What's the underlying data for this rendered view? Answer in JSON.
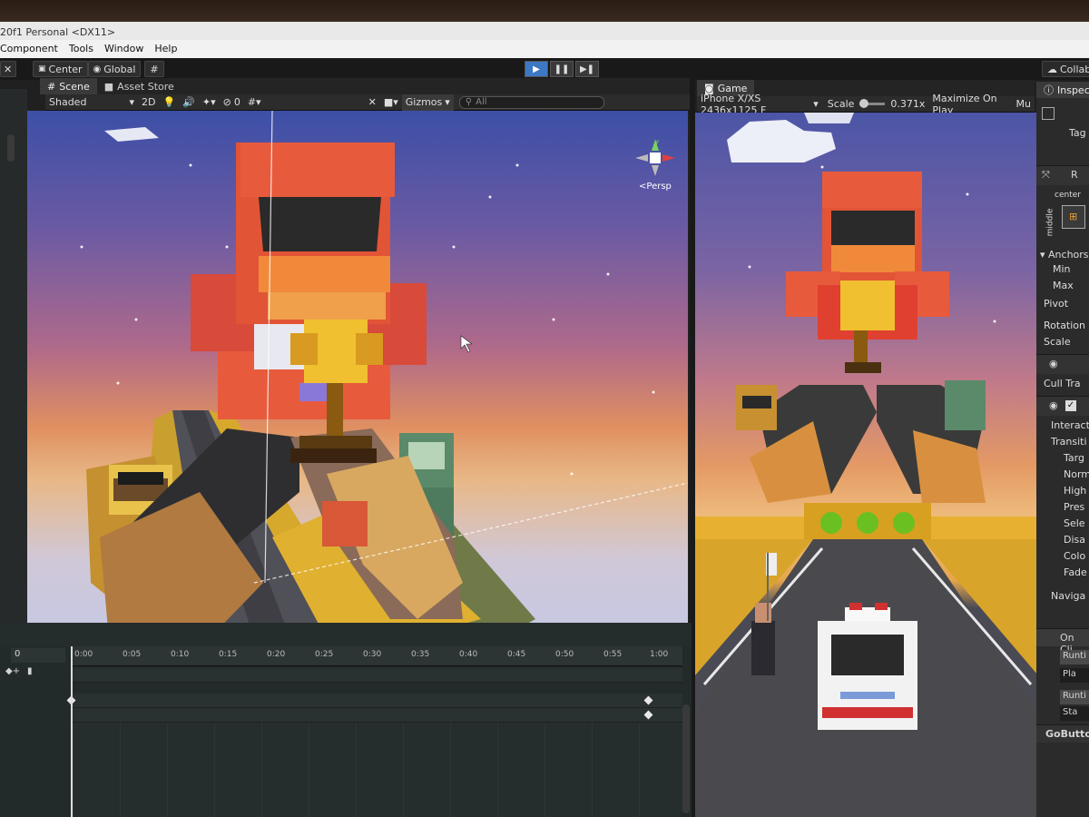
{
  "window": {
    "title": "20f1 Personal <DX11>",
    "menu": [
      "Component",
      "Tools",
      "Window",
      "Help"
    ]
  },
  "toolbar": {
    "pivot_label": "Center",
    "space_label": "Global",
    "collab_label": "Collab"
  },
  "scene_panel": {
    "tabs": [
      "Scene",
      "Asset Store"
    ],
    "shading_mode": "Shaded",
    "mode_2d": "2D",
    "hidden_count": "0",
    "gizmos_label": "Gizmos",
    "search_placeholder": "All",
    "persp_label": "Persp"
  },
  "game_panel": {
    "tab": "Game",
    "resolution": "iPhone X/XS 2436x1125 F",
    "scale_label": "Scale",
    "scale_value": "0.371x",
    "maximize_label": "Maximize On Play",
    "mute_label": "Mu"
  },
  "inspector": {
    "tab": "Inspecto",
    "tag_label": "Tag",
    "rect_label": "R",
    "center_label": "center",
    "middle_label": "middle",
    "anchors_label": "Anchors",
    "min_label": "Min",
    "max_label": "Max",
    "pivot_label": "Pivot",
    "rotation_label": "Rotation",
    "scale_label": "Scale",
    "cull_label": "Cull Tra",
    "interactable_label": "Interact",
    "transition_label": "Transiti",
    "transition_items": [
      "Targ",
      "Norm",
      "High",
      "Pres",
      "Sele",
      "Disa",
      "Colo",
      "Fade"
    ],
    "navigation_label": "Naviga",
    "onclick_label": "On Cli",
    "runtime_1": "Runti",
    "object_1": "Pla",
    "runtime_2": "Runti",
    "object_2": "Sta",
    "component_label": "GoButton"
  },
  "timeline": {
    "frame_value": "0",
    "ticks": [
      "0:00",
      "0:05",
      "0:10",
      "0:15",
      "0:20",
      "0:25",
      "0:30",
      "0:35",
      "0:40",
      "0:45",
      "0:50",
      "0:55",
      "1:00"
    ]
  }
}
